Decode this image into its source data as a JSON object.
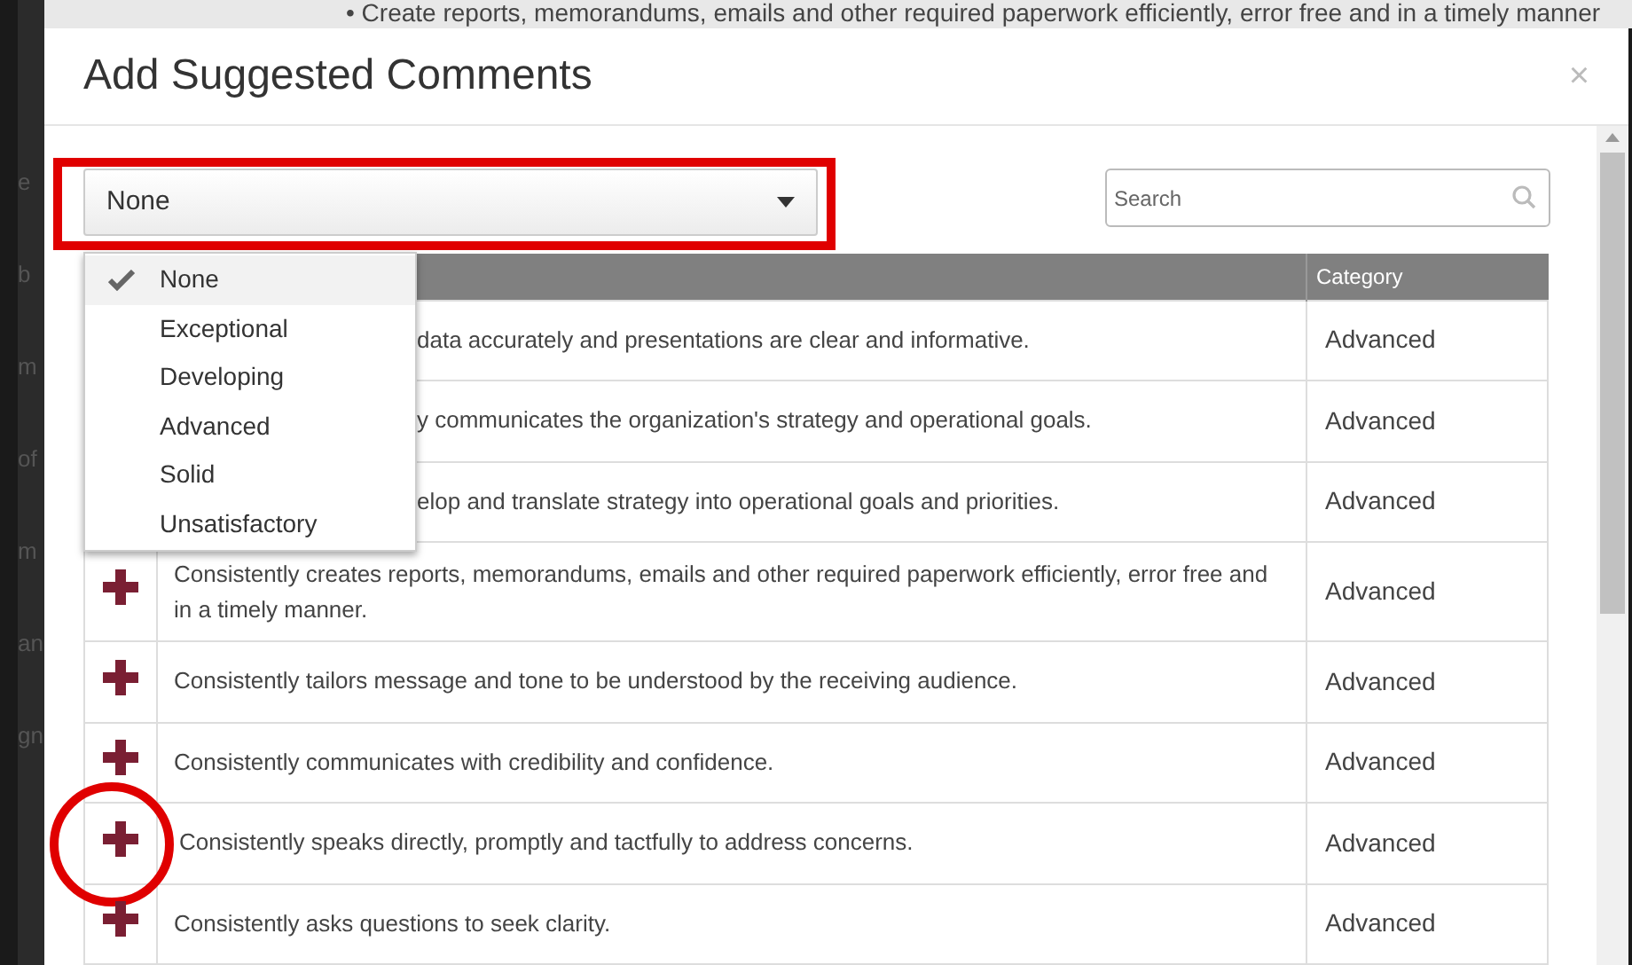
{
  "background": {
    "top_bullet": "•",
    "top_text": "Create reports, memorandums, emails and other required paperwork efficiently, error free and in a timely manner",
    "side_fragments": [
      "e",
      "b",
      "m",
      "of",
      "m",
      "an",
      "gn"
    ]
  },
  "dialog": {
    "title": "Add Suggested Comments",
    "close": "×"
  },
  "filter": {
    "value": "None",
    "open": true,
    "options": [
      {
        "label": "None",
        "selected": true
      },
      {
        "label": "Exceptional",
        "selected": false
      },
      {
        "label": "Developing",
        "selected": false
      },
      {
        "label": "Advanced",
        "selected": false
      },
      {
        "label": "Solid",
        "selected": false
      },
      {
        "label": "Unsatisfactory",
        "selected": false
      }
    ]
  },
  "search": {
    "placeholder": "Search"
  },
  "table": {
    "columns": [
      "Category"
    ],
    "rows": [
      {
        "kind": "covered",
        "comment": "data accurately and presentations are clear and informative.",
        "category": "Advanced"
      },
      {
        "kind": "covered",
        "comment": "y communicates the organization's strategy and operational goals.",
        "category": "Advanced"
      },
      {
        "kind": "covered",
        "comment": "elop and translate strategy into operational goals and priorities.",
        "category": "Advanced"
      },
      {
        "kind": "full",
        "comment": "Consistently creates reports, memorandums, emails and other required paperwork efficiently, error free and in a timely manner.",
        "category": "Advanced"
      },
      {
        "kind": "full",
        "comment": "Consistently tailors message and tone to be understood by the receiving audience.",
        "category": "Advanced"
      },
      {
        "kind": "full",
        "comment": "Consistently communicates with credibility and confidence.",
        "category": "Advanced"
      },
      {
        "kind": "full",
        "comment": "Consistently speaks directly, promptly and tactfully to address concerns.",
        "category": "Advanced",
        "circled": true
      },
      {
        "kind": "full",
        "comment": "Consistently asks questions to seek clarity.",
        "category": "Advanced"
      }
    ]
  },
  "highlight_filter": true
}
